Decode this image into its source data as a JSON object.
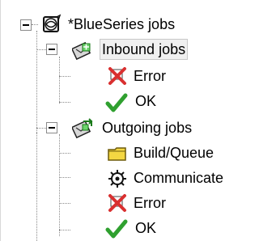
{
  "tree": {
    "root": {
      "label": "*BlueSeries jobs",
      "icon": "globe-icon"
    },
    "inbound": {
      "label": "Inbound jobs",
      "icon": "inbound-jobs-icon",
      "children": [
        {
          "label": "Error",
          "icon": "error-x-icon"
        },
        {
          "label": "OK",
          "icon": "checkmark-icon"
        }
      ]
    },
    "outgoing": {
      "label": "Outgoing jobs",
      "icon": "outgoing-jobs-icon",
      "children": [
        {
          "label": "Build/Queue",
          "icon": "folder-icon"
        },
        {
          "label": "Communicate",
          "icon": "gear-icon"
        },
        {
          "label": "Error",
          "icon": "error-x-icon"
        },
        {
          "label": "OK",
          "icon": "checkmark-icon"
        }
      ]
    }
  },
  "colors": {
    "check": "#2fa02f",
    "error": "#d93030",
    "folder": "#f4d742"
  }
}
